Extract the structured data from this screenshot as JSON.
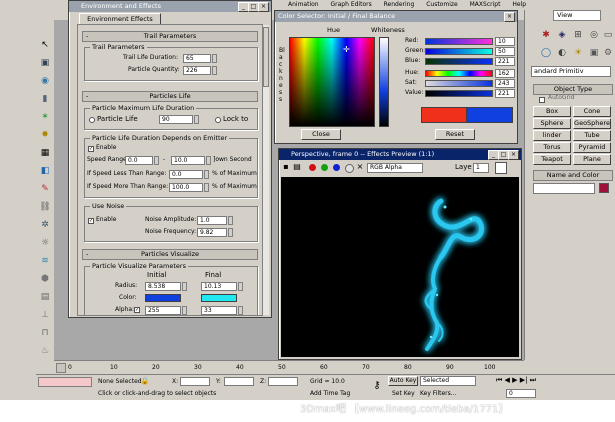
{
  "env": {
    "title": "Environment and Effects",
    "tab": "Environment Effects",
    "trail": {
      "header": "Trail Parameters",
      "group": "Trail Parameters",
      "life_label": "Trail Life Duration:",
      "life_value": "65",
      "qty_label": "Particle Quantity:",
      "qty_value": "226"
    },
    "life": {
      "header": "Particles Life",
      "group": "Particle Maximum Life Duration",
      "radio_label": "Particle Life",
      "radio_value": "90",
      "lock_label": "Lock to"
    },
    "dur": {
      "group": "Particle Life Duration Depends on Emitter",
      "enable": "Enable",
      "speed_label": "Speed Range:",
      "speed_from": "0.0",
      "speed_to": "10.0",
      "speed_suffix": "]own Second",
      "less_label": "If Speed Less Than Range:",
      "less_value": "0.0",
      "less_suffix": "% of Maximum",
      "more_label": "If Speed More Than Range:",
      "more_value": "100.0",
      "more_suffix": "% of Maximum"
    },
    "noise": {
      "group": "Use Noise",
      "enable": "Enable",
      "amp_label": "Noise Amplitude:",
      "amp_value": "1.0",
      "freq_label": "Noise Frequency:",
      "freq_value": "9.82"
    },
    "vis": {
      "header": "Particles Visualize",
      "group": "Particle Visualize Parameters",
      "initial": "Initial",
      "final": "Final",
      "radius_label": "Radius:",
      "radius_initial": "8.538",
      "radius_final": "10.13",
      "color_label": "Color:",
      "alpha_label": "Alpha:",
      "alpha_initial": "255",
      "alpha_final": "33"
    }
  },
  "colors": {
    "title": "Color Selector: Initial / Final Balance",
    "hue": "Hue",
    "whiteness": "Whiteness",
    "blackness": "Blackness",
    "sliders": [
      {
        "label": "Red:",
        "value": "10"
      },
      {
        "label": "Green:",
        "value": "50"
      },
      {
        "label": "Blue:",
        "value": "221"
      },
      {
        "label": "Hue:",
        "value": "162"
      },
      {
        "label": "Sat:",
        "value": "243"
      },
      {
        "label": "Value:",
        "value": "221"
      }
    ],
    "close": "Close",
    "reset": "Reset",
    "initial_color": "#1040e0",
    "final_color": "#20e8f0"
  },
  "preview": {
    "title": "Perspective, frame 0 -- Effects Preview (1:1)",
    "channel": "RGB Alpha",
    "layer_label": "Laye",
    "layer_value": "1"
  },
  "right_panel": {
    "view": "View",
    "dropdown": "andard Primitiv",
    "object_type": "Object Type",
    "autogrid": "AutoGrid",
    "buttons": [
      "Box",
      "Cone",
      "Sphere",
      "GeoSphere",
      "linder",
      "Tube",
      "Torus",
      "Pyramid",
      "Teapot",
      "Plane"
    ],
    "name_color": "Name and Color"
  },
  "menubar": [
    "Animation",
    "Graph Editors",
    "Rendering",
    "Customize",
    "MAXScript",
    "Help"
  ],
  "timeline": {
    "ticks": [
      "0",
      "10",
      "20",
      "30",
      "40",
      "50",
      "60",
      "70",
      "80",
      "90",
      "100"
    ]
  },
  "status": {
    "selected": "None Selected",
    "x": "X:",
    "y": "Y:",
    "z": "Z:",
    "grid": "Grid = 10.0",
    "prompt": "Click or click-and-drag to select objects",
    "add_time_tag": "Add Time Tag",
    "auto_key": "Auto Key",
    "selected_label": "Selected",
    "set_key": "Set Key",
    "key_filters": "Key Filters...",
    "frame": "0",
    "watermark": "3Dmax吧 【www.lineeg.com/tieba/1771】"
  }
}
